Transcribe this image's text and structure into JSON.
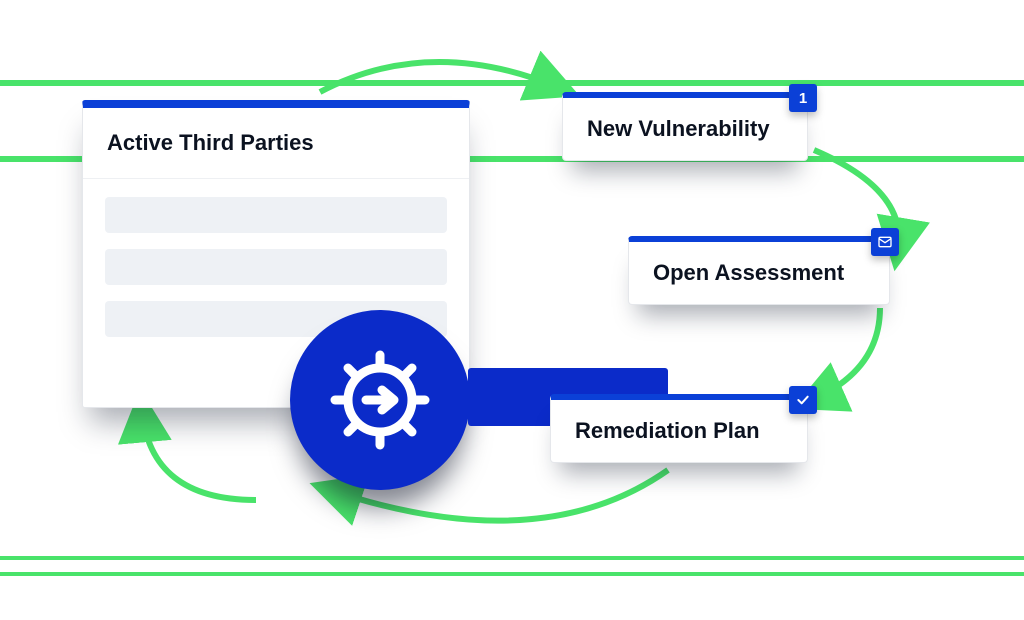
{
  "panel": {
    "title": "Active Third Parties"
  },
  "hub": {
    "icon_name": "gear-arrow-icon"
  },
  "steps": {
    "new_vulnerability": {
      "label": "New Vulnerability",
      "badge": "1"
    },
    "open_assessment": {
      "label": "Open Assessment"
    },
    "remediation_plan": {
      "label": "Remediation Plan"
    }
  },
  "colors": {
    "accent_blue": "#0b40d7",
    "flow_green": "#49e36a"
  }
}
